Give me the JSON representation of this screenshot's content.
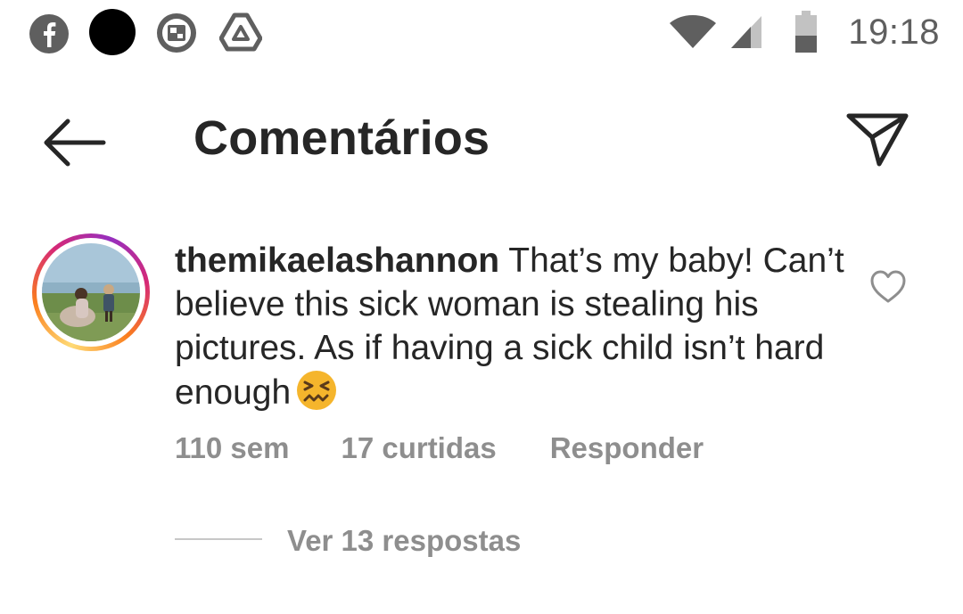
{
  "status_bar": {
    "time": "19:18",
    "icons": [
      "facebook-icon",
      "notification-dot-icon",
      "screen-record-icon",
      "drive-icon",
      "wifi-icon",
      "signal-icon",
      "battery-icon"
    ]
  },
  "header": {
    "title": "Comentários",
    "back_icon": "arrow-left-icon",
    "share_icon": "paper-plane-icon"
  },
  "comment": {
    "username": "themikaelashannon",
    "text": " That’s my baby! Can’t believe this sick woman is stealing his pictures. As if having a sick child isn’t hard enough",
    "emoji": "confounded-face-emoji",
    "time": "110 sem",
    "likes": "17 curtidas",
    "reply_label": "Responder",
    "view_replies": "Ver 13 respostas"
  },
  "colors": {
    "text_primary": "#262626",
    "text_secondary": "#8e8e8e",
    "status_icons": "#5f5f5f"
  }
}
